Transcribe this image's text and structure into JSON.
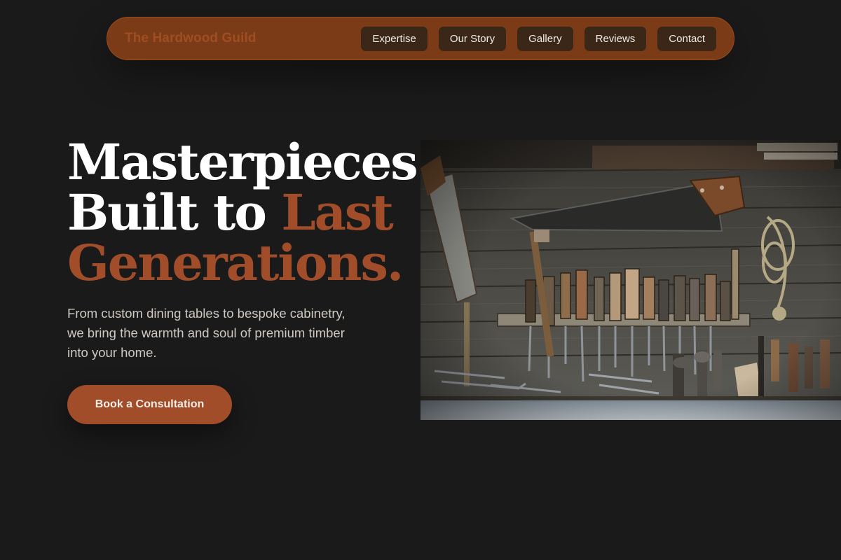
{
  "brand": {
    "name": "The Hardwood Guild"
  },
  "nav": {
    "items": [
      {
        "label": "Expertise"
      },
      {
        "label": "Our Story"
      },
      {
        "label": "Gallery"
      },
      {
        "label": "Reviews"
      },
      {
        "label": "Contact"
      }
    ]
  },
  "hero": {
    "headline_line1": "Masterpieces",
    "headline_line2_start": "Built to ",
    "headline_line2_accent": "Last",
    "headline_line3_accent": "Generations.",
    "subtitle": "From custom dining tables to bespoke cabinetry, we bring the warmth and soul of premium timber into your home.",
    "cta_label": "Book a Consultation",
    "image_label": "workshop-tools-photo"
  },
  "colors": {
    "background": "#1a1a1a",
    "nav_bg": "#7a3b16",
    "accent": "#a14d2a",
    "nav_button_bg": "#3a2718"
  }
}
